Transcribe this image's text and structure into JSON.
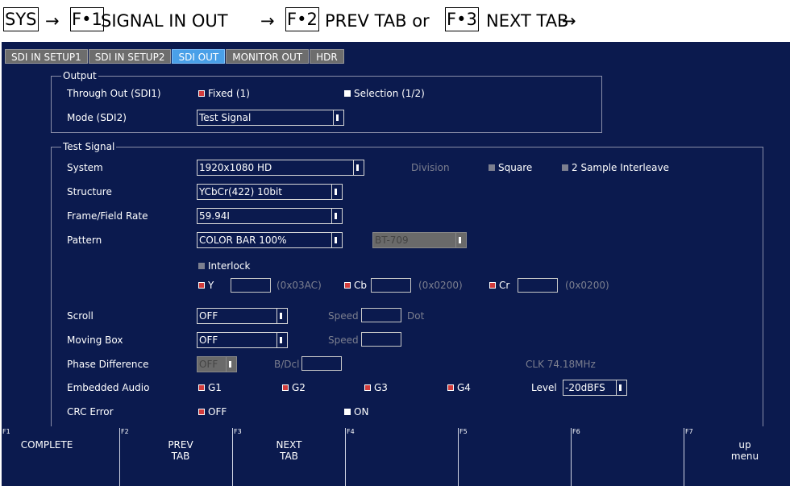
{
  "breadcrumb": {
    "sys": "SYS",
    "arrow": "→",
    "f1": "F•1",
    "t1": "SIGNAL IN OUT",
    "f2": "F•2",
    "t2": "PREV TAB or",
    "f3": "F•3",
    "t3": "NEXT TAB"
  },
  "tabs": [
    {
      "label": "SDI IN SETUP1"
    },
    {
      "label": "SDI IN SETUP2"
    },
    {
      "label": "SDI OUT",
      "active": true
    },
    {
      "label": "MONITOR OUT"
    },
    {
      "label": "HDR"
    }
  ],
  "output": {
    "title": "Output",
    "through_out_label": "Through Out (SDI1)",
    "fixed_label": "Fixed (1)",
    "selection_label": "Selection (1/2)",
    "mode_label": "Mode (SDI2)",
    "mode_value": "Test Signal"
  },
  "test_signal": {
    "title": "Test Signal",
    "system_label": "System",
    "system_value": "1920x1080 HD",
    "division_label": "Division",
    "square_label": "Square",
    "sample_label": "2 Sample Interleave",
    "structure_label": "Structure",
    "structure_value": "YCbCr(422) 10bit",
    "rate_label": "Frame/Field Rate",
    "rate_value": "59.94I",
    "pattern_label": "Pattern",
    "pattern_value": "COLOR BAR 100%",
    "colorimetry_value": "BT-709",
    "interlock_label": "Interlock",
    "y_label": "Y",
    "y_hex": "(0x03AC)",
    "cb_label": "Cb",
    "cb_hex": "(0x0200)",
    "cr_label": "Cr",
    "cr_hex": "(0x0200)",
    "scroll_label": "Scroll",
    "scroll_value": "OFF",
    "speed_label": "Speed",
    "dot_label": "Dot",
    "moving_box_label": "Moving Box",
    "moving_box_value": "OFF",
    "speed2_label": "Speed",
    "phase_label": "Phase Difference",
    "phase_value": "OFF",
    "bdcl_label": "B/Dcl",
    "clk_label": "CLK 74.18MHz",
    "audio_label": "Embedded Audio",
    "g1": "G1",
    "g2": "G2",
    "g3": "G3",
    "g4": "G4",
    "level_label": "Level",
    "level_value": "-20dBFS",
    "crc_label": "CRC Error",
    "crc_off": "OFF",
    "crc_on": "ON"
  },
  "fkeys": {
    "f1_num": "F1",
    "f1_label": "COMPLETE",
    "f2_num": "F2",
    "f2_l1": "PREV",
    "f2_l2": "TAB",
    "f3_num": "F3",
    "f3_l1": "NEXT",
    "f3_l2": "TAB",
    "f4_num": "F4",
    "f5_num": "F5",
    "f6_num": "F6",
    "f7_num": "F7",
    "f7_l1": "up",
    "f7_l2": "menu"
  },
  "colors": {
    "screen_bg": "#0b1a4e",
    "active_tab": "#4aa0e8",
    "inactive_tab": "#6d6d6d",
    "check_on": "#d23c3c",
    "dim_text": "#7c7f8f"
  }
}
